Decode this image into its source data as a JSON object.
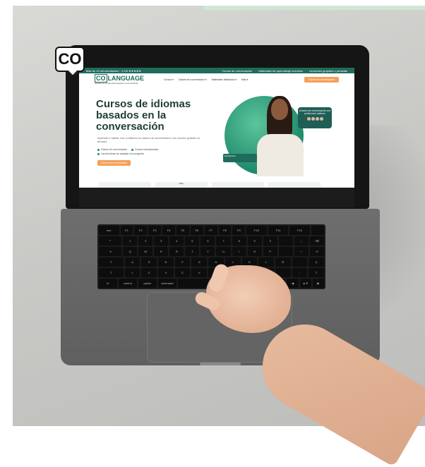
{
  "badge": {
    "label": "CO"
  },
  "website": {
    "topbar": {
      "left": "Más de 10 mil estudiantes · 4,9/5 ★★★★★",
      "links": [
        "Cursos de conversación",
        "Materiales de aprendizaje incluidos",
        "Lecciones grupales o privadas"
      ]
    },
    "logo": {
      "box": "CO",
      "rest": "LANGUAGE",
      "tagline": "Academia de idiomas basada en conversación"
    },
    "nav": {
      "items": [
        "Cursos ▾",
        "Clases de conversación ▾",
        "Materiales didácticos ▾",
        "Más ▾"
      ],
      "cta": "Clases de conversación"
    },
    "hero": {
      "title": "Cursos de idiomas basados en la conversación",
      "description": "Aprende a hablar con confianza en clases de conversación con acceso gratuito al temario.",
      "features": [
        "Clases de conversación",
        "Cursos estructurados",
        "Las lecciones se adaptan a tu progreso"
      ],
      "cta": "Clases de conversación"
    },
    "callout": {
      "text": "¡Clases de conversación con profesores nativos!"
    },
    "students_card": {
      "text": "Estudiantes"
    },
    "stat_cards": [
      "",
      "10K+",
      "",
      ""
    ]
  },
  "keyboard": {
    "rows": [
      [
        "esc",
        "F1",
        "F2",
        "F3",
        "F4",
        "F5",
        "F6",
        "F7",
        "F8",
        "F9",
        "F10",
        "F11",
        "F12",
        ""
      ],
      [
        "º",
        "1",
        "2",
        "3",
        "4",
        "5",
        "6",
        "7",
        "8",
        "9",
        "0",
        "'",
        "¡",
        "⌫"
      ],
      [
        "⇥",
        "Q",
        "W",
        "E",
        "R",
        "T",
        "Y",
        "U",
        "I",
        "O",
        "P",
        "`",
        "+",
        "⏎"
      ],
      [
        "⇪",
        "A",
        "S",
        "D",
        "F",
        "G",
        "H",
        "J",
        "K",
        "L",
        "Ñ",
        "´",
        "Ç"
      ],
      [
        "⇧",
        "<",
        "Z",
        "X",
        "C",
        "V",
        "B",
        "N",
        "M",
        ",",
        ".",
        "-",
        "⇧"
      ],
      [
        "fn",
        "control",
        "option",
        "command",
        "",
        "command",
        "option",
        "◀",
        "▲▼",
        "▶"
      ]
    ]
  }
}
